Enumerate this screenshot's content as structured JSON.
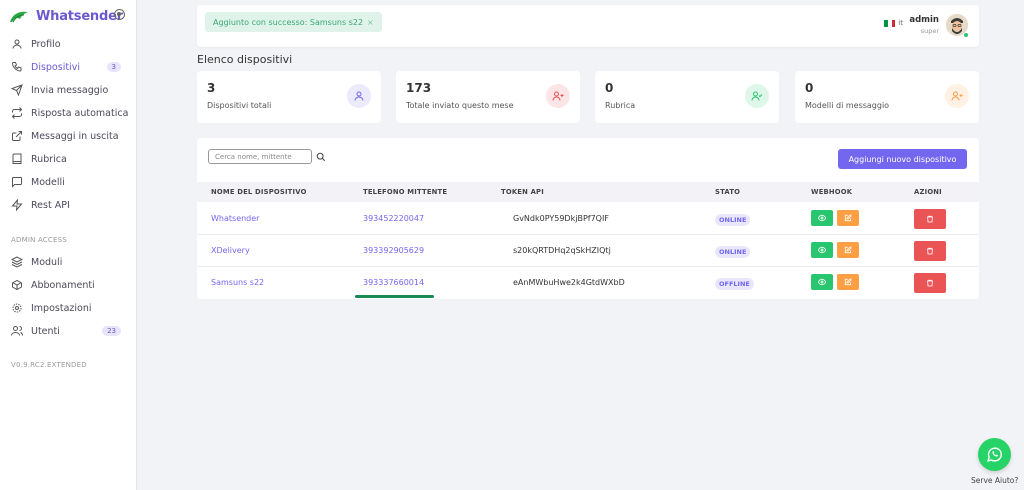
{
  "app": {
    "name": "Whatsender",
    "version": "V0.9.RC2.EXTENDED"
  },
  "sidebar": {
    "items": [
      {
        "label": "Profilo",
        "icon": "user-icon"
      },
      {
        "label": "Dispositivi",
        "icon": "phone-icon",
        "badge": "3"
      },
      {
        "label": "Invia messaggio",
        "icon": "send-icon"
      },
      {
        "label": "Risposta automatica",
        "icon": "repeat-icon"
      },
      {
        "label": "Messaggi in uscita",
        "icon": "external-link-icon"
      },
      {
        "label": "Rubrica",
        "icon": "book-icon"
      },
      {
        "label": "Modelli",
        "icon": "message-square-icon"
      },
      {
        "label": "Rest API",
        "icon": "zap-icon"
      }
    ],
    "admin_label": "ADMIN ACCESS",
    "admin_items": [
      {
        "label": "Moduli",
        "icon": "layers-icon"
      },
      {
        "label": "Abbonamenti",
        "icon": "package-icon"
      },
      {
        "label": "Impostazioni",
        "icon": "settings-icon"
      },
      {
        "label": "Utenti",
        "icon": "users-icon",
        "badge": "23"
      }
    ]
  },
  "topbar": {
    "alert": "Aggiunto con successo: Samsuns s22",
    "alert_close": "×",
    "lang": "it",
    "user_name": "admin",
    "user_role": "super"
  },
  "page": {
    "title": "Elenco dispositivi"
  },
  "stats": [
    {
      "value": "3",
      "label": "Dispositivi totali",
      "icon": "user-icon",
      "color": "#7367f0"
    },
    {
      "value": "173",
      "label": "Totale inviato questo mese",
      "icon": "user-plus-icon",
      "color": "#ea5455"
    },
    {
      "value": "0",
      "label": "Rubrica",
      "icon": "user-check-icon",
      "color": "#28c76f"
    },
    {
      "value": "0",
      "label": "Modelli di messaggio",
      "icon": "user-plus-icon",
      "color": "#ff9f43"
    }
  ],
  "devices": {
    "search_placeholder": "Cerca nome, mittente",
    "add_button": "Aggiungi nuovo dispositivo",
    "columns": [
      "NOME DEL DISPOSITIVO",
      "TELEFONO MITTENTE",
      "TOKEN API",
      "STATO",
      "WEBHOOK",
      "AZIONI"
    ],
    "rows": [
      {
        "name": "Whatsender",
        "phone": "393452220047",
        "token": "GvNdk0PY59DkjBPf7QIF",
        "status": "ONLINE"
      },
      {
        "name": "XDelivery",
        "phone": "393392905629",
        "token": "s20kQRTDHq2qSkHZIQtj",
        "status": "ONLINE"
      },
      {
        "name": "Samsuns s22",
        "phone": "393337660014",
        "token": "eAnMWbuHwe2k4GtdWXbD",
        "status": "OFFLINE"
      }
    ]
  },
  "help": {
    "label": "Serve Aiuto?",
    "icon": "whatsapp-icon"
  }
}
